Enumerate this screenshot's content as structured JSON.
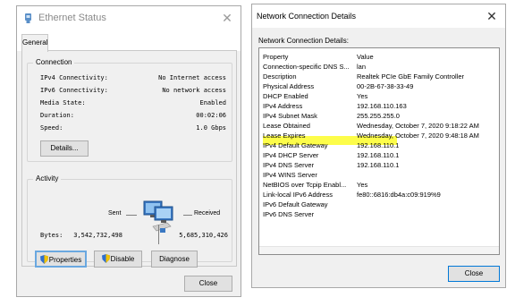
{
  "left_window": {
    "title": "Ethernet Status",
    "tab": "General",
    "connection": {
      "group_title": "Connection",
      "rows": [
        {
          "label": "IPv4 Connectivity:",
          "value": "No Internet access"
        },
        {
          "label": "IPv6 Connectivity:",
          "value": "No network access"
        },
        {
          "label": "Media State:",
          "value": "Enabled"
        },
        {
          "label": "Duration:",
          "value": "00:02:06"
        },
        {
          "label": "Speed:",
          "value": "1.0 Gbps"
        }
      ],
      "details_button": "Details..."
    },
    "activity": {
      "group_title": "Activity",
      "sent_label": "Sent",
      "received_label": "Received",
      "bytes_label": "Bytes:",
      "bytes_sent": "3,542,732,498",
      "bytes_received": "5,685,310,426"
    },
    "buttons": {
      "properties": "Properties",
      "disable": "Disable",
      "diagnose": "Diagnose"
    },
    "close_button": "Close"
  },
  "right_window": {
    "title": "Network Connection Details",
    "heading": "Network Connection Details:",
    "columns": {
      "property": "Property",
      "value": "Value"
    },
    "rows": [
      {
        "property": "Connection-specific DNS S...",
        "value": "lan"
      },
      {
        "property": "Description",
        "value": "Realtek PCIe GbE Family Controller"
      },
      {
        "property": "Physical Address",
        "value": "00-2B-67-38-33-49"
      },
      {
        "property": "DHCP Enabled",
        "value": "Yes"
      },
      {
        "property": "IPv4 Address",
        "value": "192.168.110.163"
      },
      {
        "property": "IPv4 Subnet Mask",
        "value": "255.255.255.0"
      },
      {
        "property": "Lease Obtained",
        "value": "Wednesday, October 7, 2020 9:18:22 AM"
      },
      {
        "property": "Lease Expires",
        "value": "Wednesday, October 7, 2020 9:48:18 AM"
      },
      {
        "property": "IPv4 Default Gateway",
        "value": "192.168.110.1"
      },
      {
        "property": "IPv4 DHCP Server",
        "value": "192.168.110.1"
      },
      {
        "property": "IPv4 DNS Server",
        "value": "192.168.110.1"
      },
      {
        "property": "IPv4 WINS Server",
        "value": ""
      },
      {
        "property": "NetBIOS over Tcpip Enabl...",
        "value": "Yes"
      },
      {
        "property": "Link-local IPv6 Address",
        "value": "fe80::6816:db4a:c09:919%9"
      },
      {
        "property": "IPv6 Default Gateway",
        "value": ""
      },
      {
        "property": "IPv6 DNS Server",
        "value": ""
      }
    ],
    "close_button": "Close"
  },
  "colors": {
    "highlight": "#fdfd4a",
    "focus_border": "#0078d7"
  }
}
